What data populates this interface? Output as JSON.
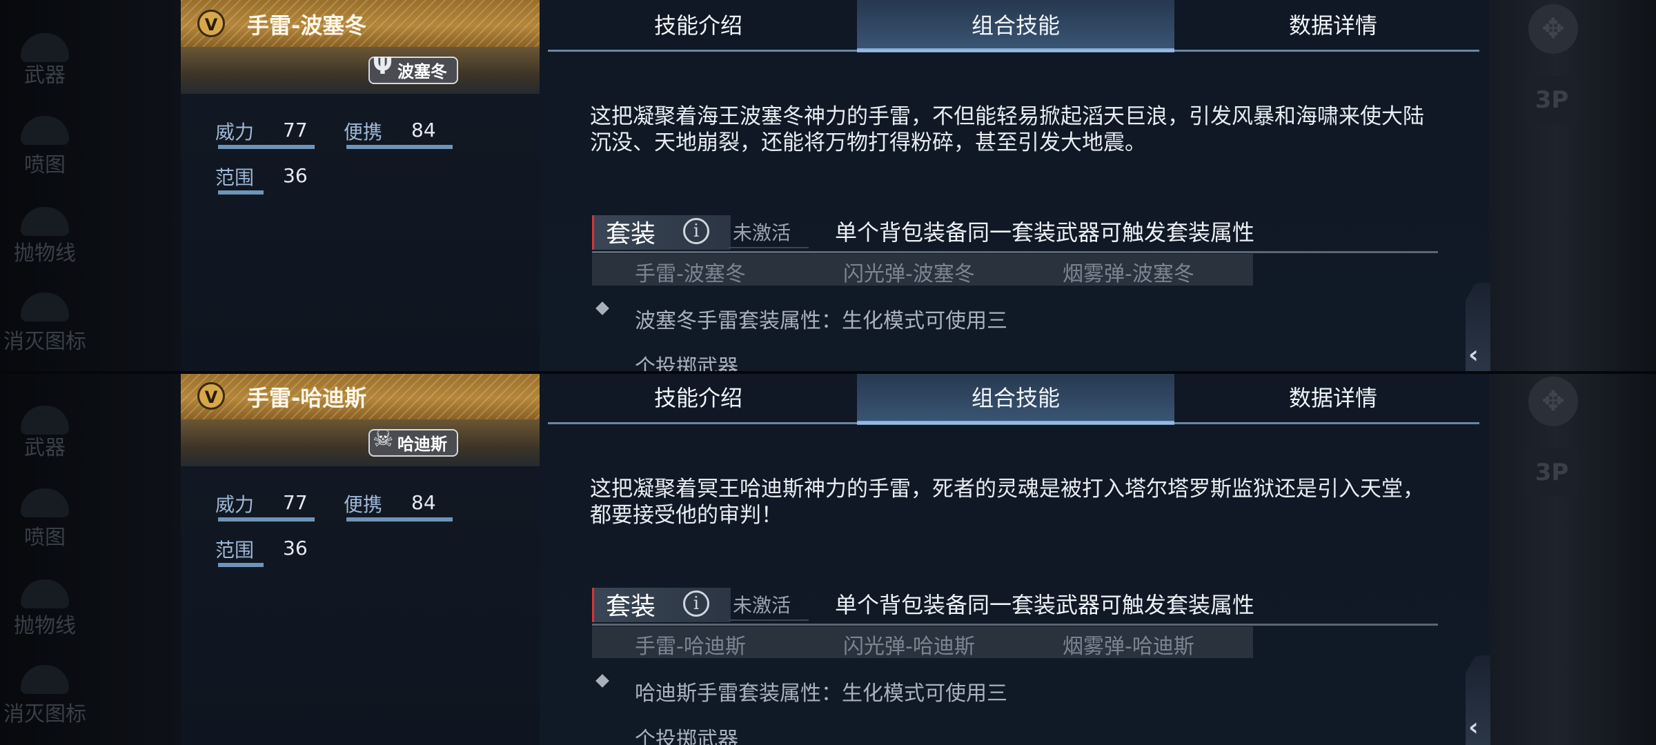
{
  "sidebar": {
    "items": [
      {
        "label": "武器"
      },
      {
        "label": "喷图"
      },
      {
        "label": "抛物线"
      },
      {
        "label": "消灭图标"
      }
    ]
  },
  "right_controls": {
    "camera_label": "3P"
  },
  "tabs": [
    {
      "label": "技能介绍"
    },
    {
      "label": "组合技能",
      "active": true
    },
    {
      "label": "数据详情"
    }
  ],
  "panels": [
    {
      "weapon_name": "手雷-波塞冬",
      "badge": "V",
      "series_logo": "波塞冬",
      "stats": {
        "power_label": "威力",
        "power_value": "77",
        "portability_label": "便携",
        "portability_value": "84",
        "range_label": "范围",
        "range_value": "36"
      },
      "description": "这把凝聚着海王波塞冬神力的手雷，不但能轻易掀起滔天巨浪，引发风暴和海啸来使大陆沉没、天地崩裂，还能将万物打得粉碎，甚至引发大地震。",
      "set": {
        "label": "套装",
        "status": "未激活",
        "rule": "单个背包装备同一套装武器可触发套装属性",
        "items": [
          "手雷-波塞冬",
          "闪光弹-波塞冬",
          "烟雾弹-波塞冬"
        ],
        "bonus": "波塞冬手雷套装属性：生化模式可使用三个投掷武器"
      }
    },
    {
      "weapon_name": "手雷-哈迪斯",
      "badge": "V",
      "series_logo": "哈迪斯",
      "stats": {
        "power_label": "威力",
        "power_value": "77",
        "portability_label": "便携",
        "portability_value": "84",
        "range_label": "范围",
        "range_value": "36"
      },
      "description": "这把凝聚着冥王哈迪斯神力的手雷，死者的灵魂是被打入塔尔塔罗斯监狱还是引入天堂，都要接受他的审判！",
      "set": {
        "label": "套装",
        "status": "未激活",
        "rule": "单个背包装备同一套装武器可触发套装属性",
        "items": [
          "手雷-哈迪斯",
          "闪光弹-哈迪斯",
          "烟雾弹-哈迪斯"
        ],
        "bonus": "哈迪斯手雷套装属性：生化模式可使用三个投掷武器"
      }
    }
  ]
}
